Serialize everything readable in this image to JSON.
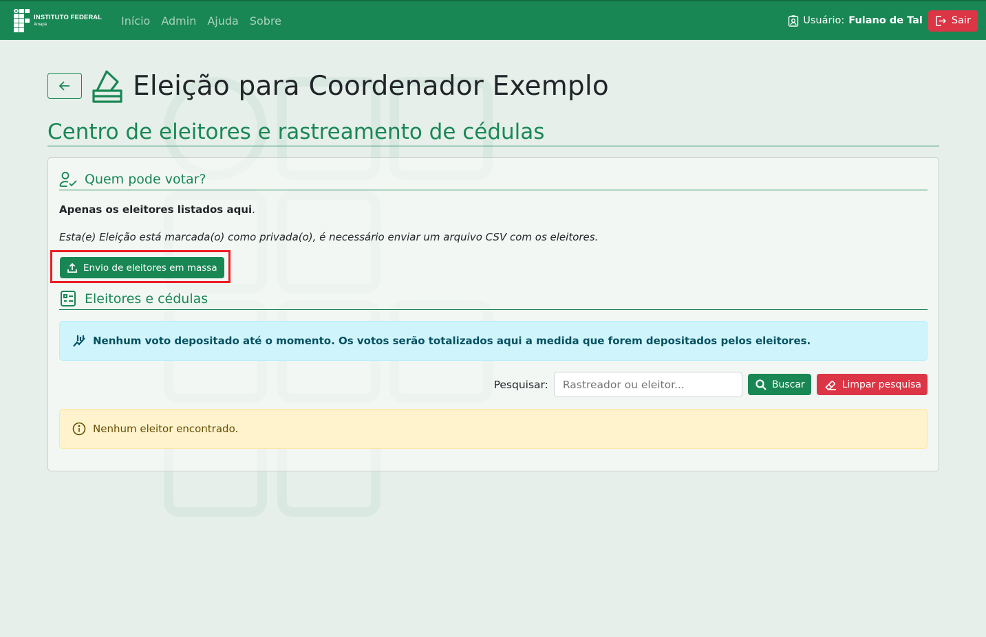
{
  "brand": {
    "title": "INSTITUTO FEDERAL",
    "subtitle": "Amapá"
  },
  "nav": {
    "items": [
      "Início",
      "Admin",
      "Ajuda",
      "Sobre"
    ]
  },
  "user": {
    "label": "Usuário:",
    "name": "Fulano de Tal",
    "logout_label": "Sair"
  },
  "page": {
    "title": "Eleição para Coordenador Exemplo",
    "subtitle": "Centro de eleitores e rastreamento de cédulas"
  },
  "voters_section": {
    "heading": "Quem pode votar?",
    "strong_text": "Apenas os eleitores listados aqui",
    "strong_suffix": ".",
    "private_note": "Esta(e) Eleição está marcada(o) como privada(o), é necessário enviar um arquivo CSV com os eleitores.",
    "upload_button": "Envio de eleitores em massa"
  },
  "ballots_section": {
    "heading": "Eleitores e cédulas",
    "info_alert": "Nenhum voto depositado até o momento. Os votos serão totalizados aqui a medida que forem depositados pelos eleitores.",
    "search_label": "Pesquisar:",
    "search_placeholder": "Rastreador ou eleitor...",
    "search_button": "Buscar",
    "clear_button": "Limpar pesquisa",
    "empty_alert": "Nenhum eleitor encontrado."
  },
  "icons": {
    "back": "arrow-left-icon",
    "title": "ballot-box-icon",
    "voters": "person-check-icon",
    "ballots": "list-check-icon",
    "upload": "upload-icon",
    "info": "chart-icon",
    "search": "search-icon",
    "clear": "eraser-icon",
    "warning": "info-circle-icon",
    "user": "badge-icon",
    "logout": "logout-icon"
  },
  "colors": {
    "primary": "#198754",
    "danger": "#dc3545",
    "info_bg": "#cff4fc",
    "warning_bg": "#fff3cd",
    "highlight": "#ec1c24"
  }
}
